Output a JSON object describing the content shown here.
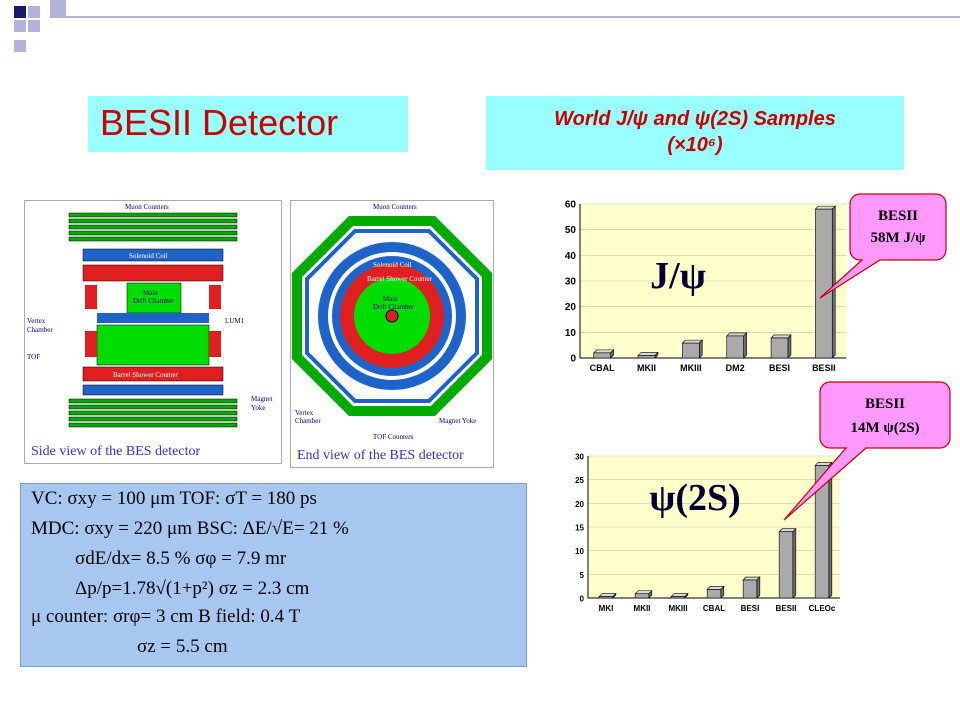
{
  "slide_title": "BESII Detector",
  "world_header": {
    "line1": "World J/ψ and ψ(2S) Samples",
    "line2": "(×10⁶)"
  },
  "detector_panels": {
    "side_view_caption": "Side view of the BES detector",
    "end_view_caption": "End view of the BES detector",
    "side_labels": {
      "muon": "Muon Counters",
      "solenoid": "Solenoid Coil",
      "main_dc": "Main",
      "drift_chamber": "Drift Chamber",
      "vertex": "Vertex",
      "chamber": "Chamber",
      "lum": "LUM1",
      "tof": "TOF",
      "bsc": "Barrel Shower Counter",
      "magnet": "Magnet",
      "yoke": "Yoke"
    },
    "end_labels": {
      "muon": "Muon Counters",
      "solenoid": "Solenoid Coil",
      "bsc": "Barrel Shower Counter",
      "main": "Main",
      "drift_chamber": "Drift Chamber",
      "vertex": "Vertex",
      "chamber": "Chamber",
      "tof": "TOF Counters",
      "magnet_yoke": "Magnet Yoke"
    }
  },
  "specs": {
    "line1": "VC:   σxy = 100  μm      TOF:  σT = 180 ps",
    "line2": "MDC: σxy =  220  μm      BSC:  ΔE/√E= 21 %",
    "line3": "σdE/dx= 8.5 %                      σφ = 7.9 mr",
    "line4": "Δp/p=1.78√(1+p²)           σz = 2.3 cm",
    "line5": "μ  counter:  σrφ= 3 cm      B field:    0.4 T",
    "line6": "σz = 5.5 cm"
  },
  "callouts": {
    "jpsi": {
      "line1": "BESII",
      "line2": "58M J/ψ"
    },
    "psi2s": {
      "line1": "BESII",
      "line2": "14M  ψ(2S)"
    }
  },
  "colors": {
    "accent": "#cc0000",
    "title_bg": "#99ffff",
    "specs_bg": "#a7c6f0",
    "chart_bg": "#ffffcc",
    "bar_front": "#aaaaaa",
    "bar_side": "#6e6e6e",
    "callout_bg": "#ff99ff",
    "callout_border": "#cc0000"
  },
  "chart_data": [
    {
      "type": "bar",
      "label": "J/ψ",
      "categories": [
        "CBAL",
        "MKII",
        "MKIII",
        "DM2",
        "BESI",
        "BESII"
      ],
      "values": [
        2,
        1,
        5.8,
        8.6,
        7.8,
        58
      ],
      "ylim": [
        0,
        60
      ],
      "yticks": [
        0,
        10,
        20,
        30,
        40,
        50,
        60
      ],
      "xlabel": "",
      "ylabel": ""
    },
    {
      "type": "bar",
      "label": "ψ(2S)",
      "categories": [
        "MKI",
        "MKII",
        "MKIII",
        "CBAL",
        "BESI",
        "BESII",
        "CLEOc"
      ],
      "values": [
        0.3,
        0.9,
        0.3,
        1.8,
        3.8,
        14,
        28
      ],
      "ylim": [
        0,
        30
      ],
      "yticks": [
        0,
        5,
        10,
        15,
        20,
        25,
        30
      ],
      "xlabel": "",
      "ylabel": ""
    }
  ]
}
